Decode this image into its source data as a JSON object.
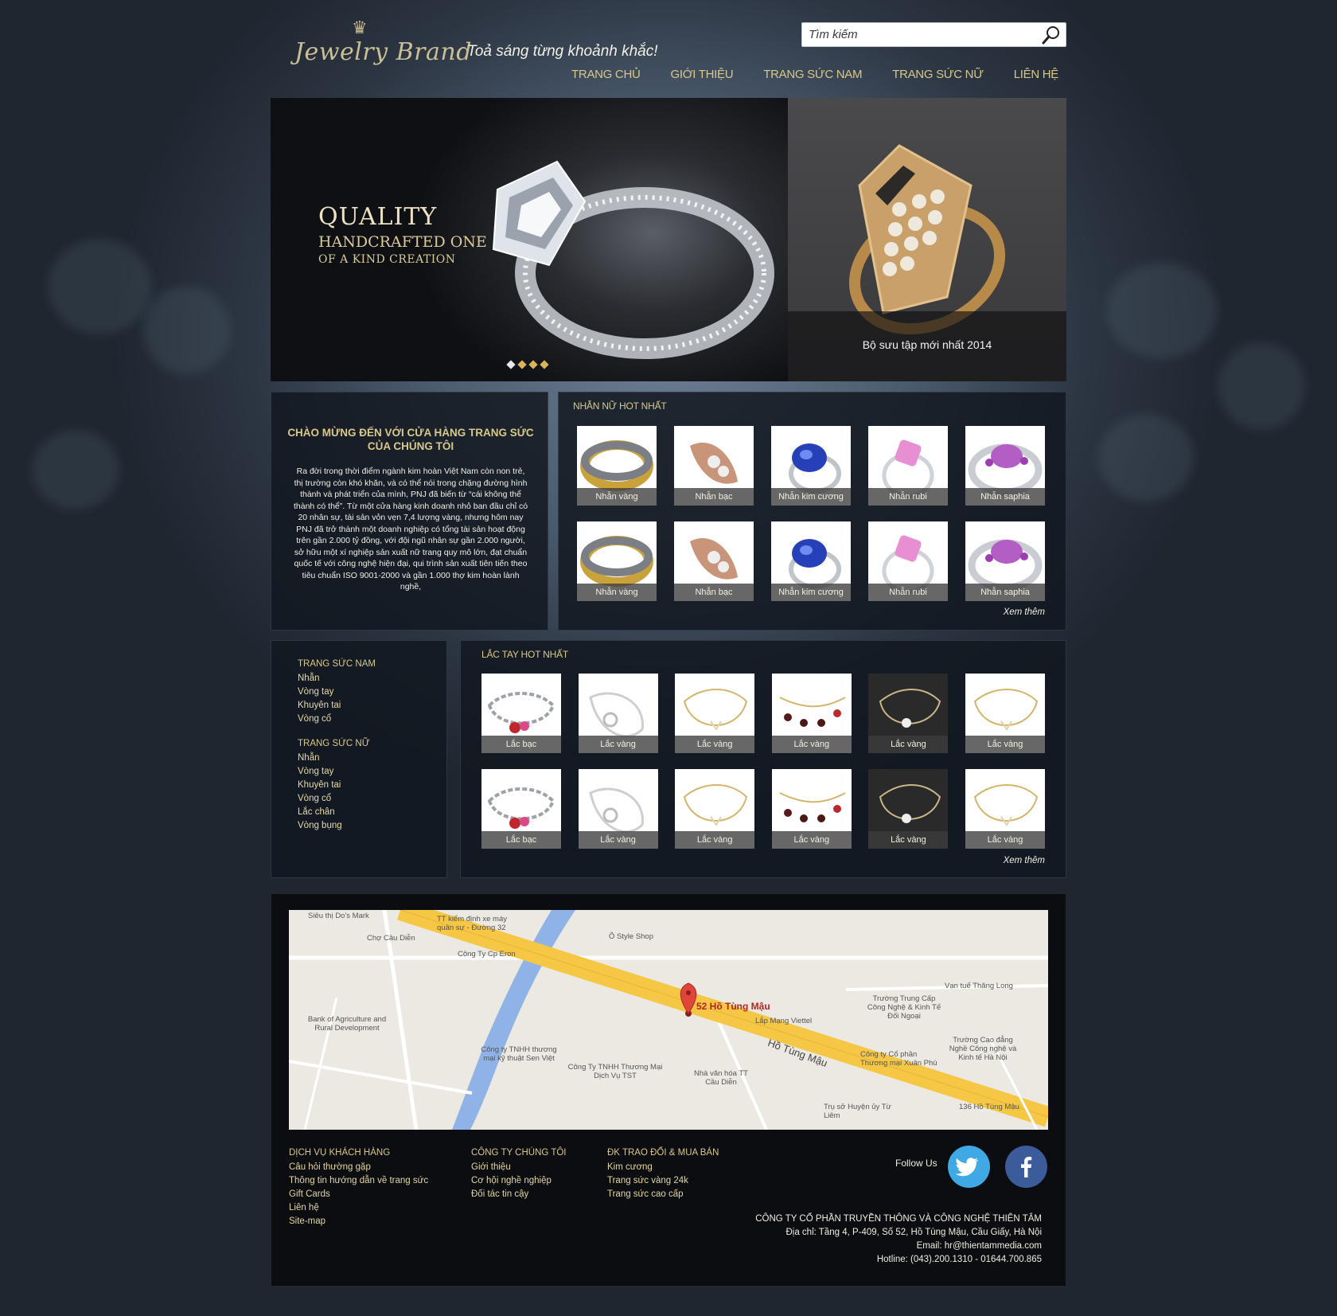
{
  "header": {
    "brand": "Jewelry Brand",
    "tagline": "Toả sáng từng khoảnh khắc!",
    "search_placeholder": "Tìm kiếm",
    "nav": [
      "TRANG CHỦ",
      "GIỚI THIỆU",
      "TRANG SỨC NAM",
      "TRANG SỨC NỮ",
      "LIÊN HỆ"
    ]
  },
  "banner": {
    "line1": "QUALITY",
    "line2": "HANDCRAFTED ONE",
    "line3": "OF A KIND CREATION",
    "caption": "Bộ sưu tập mới nhất 2014",
    "slide_count": 4
  },
  "welcome": {
    "title": "CHÀO MỪNG ĐẾN VỚI CỬA HÀNG TRANG SỨC CỦA CHÚNG TÔI",
    "body": "Ra đời trong thời điểm ngành kim hoàn Việt Nam còn non trẻ, thị trường còn khó khăn, và có thể nói trong chặng đường hình thành và phát triển của mình, PNJ đã biến từ “cái không thể thành có thể”. Từ một cửa hàng kinh doanh nhỏ ban đầu chỉ có 20 nhân sự, tài sản vỏn vẹn 7,4 lượng vàng, nhưng hôm nay PNJ đã trở thành một doanh nghiệp có tổng tài sản hoạt động trên gần 2.000 tỷ đồng, với đội ngũ nhân sự gần 2.000 người, sở hữu một xí nghiệp sản xuất nữ trang quy mô lớn, đạt chuẩn quốc tế với công nghệ hiện đại, qui trình sản xuất tiên tiến theo tiêu chuẩn ISO 9001-2000 và gần 1.000 thợ kim hoàn lành nghề,"
  },
  "rings": {
    "title": "NHẪN NỮ HOT NHẤT",
    "items": [
      "Nhẫn vàng",
      "Nhẫn bạc",
      "Nhẫn kim cương",
      "Nhẫn rubi",
      "Nhẫn saphia",
      "Nhẫn vàng",
      "Nhẫn bạc",
      "Nhẫn kim cương",
      "Nhẫn rubi",
      "Nhẫn saphia"
    ],
    "more": "Xem thêm"
  },
  "sidebar": {
    "men_title": "TRANG SỨC NAM",
    "men_items": [
      "Nhẫn",
      "Vòng tay",
      "Khuyên tai",
      "Vòng cổ"
    ],
    "women_title": "TRANG SỨC NỮ",
    "women_items": [
      "Nhẫn",
      "Vòng tay",
      "Khuyên tai",
      "Vòng cổ",
      "Lắc chân",
      "Vòng bụng"
    ]
  },
  "bracelets": {
    "title": "LẮC TAY HOT NHẤT",
    "items": [
      "Lắc bạc",
      "Lắc vàng",
      "Lắc vàng",
      "Lắc vàng",
      "Lắc vàng",
      "Lắc vàng",
      "Lắc bạc",
      "Lắc vàng",
      "Lắc vàng",
      "Lắc vàng",
      "Lắc vàng",
      "Lắc vàng"
    ],
    "more": "Xem thêm"
  },
  "map": {
    "pin": "52 Hồ Tùng Mậu",
    "road": "Hồ Tùng Mậu",
    "labels": [
      "Siêu thị Do's Mark",
      "TT kiểm định xe máy quân sự - Đường 32",
      "Chợ Cầu Diễn",
      "Công Ty Cp Eron",
      "Ô Style Shop",
      "Vạn tuế Thăng Long",
      "Trường Trung Cấp Công Nghệ & Kinh Tế Đối Ngoại",
      "Lắp Mạng Viettel",
      "Bank of Agriculture and Rural Development",
      "Công ty TNHH thương mại kỹ thuật Sen Việt",
      "Công Ty TNHH Thương Mại Dịch Vụ TST",
      "Nhà văn hóa TT Cầu Diễn",
      "Công ty Cổ phần Thương mại Xuân Phú",
      "Trường Cao đẳng Nghề Công nghệ và Kinh tế Hà Nội",
      "Trụ sở Huyện ủy Từ Liêm",
      "136 Hồ Tùng Mậu"
    ]
  },
  "footer": {
    "col1_title": "DỊCH VỤ KHÁCH HÀNG",
    "col1": [
      "Câu hỏi thường gặp",
      "Thông tin hướng dẫn về trang sức",
      "Gift Cards",
      "Liên hệ",
      "Site-map"
    ],
    "col2_title": "CÔNG TY CHÚNG TÔI",
    "col2": [
      "Giới thiệu",
      "Cơ hội nghề nghiệp",
      "Đối tác tin cậy"
    ],
    "col3_title": "ĐK TRAO ĐỔI & MUA BÁN",
    "col3": [
      "Kim cương",
      "Trang sức vàng 24k",
      "Trang sức cao cấp"
    ],
    "follow": "Follow Us",
    "company": "CÔNG TY CỔ PHẦN TRUYỀN THÔNG VÀ CÔNG NGHỆ THIÊN TÂM",
    "address": "Địa chỉ: Tầng 4, P-409, Số 52, Hồ Tùng Mậu, Cầu Giấy, Hà Nội",
    "email": "Email: hr@thientammedia.com",
    "hotline": "Hotline: (043).200.1310 - 01644.700.865"
  },
  "colors": {
    "gold": "#d9c889",
    "twitter": "#3fa9e6",
    "facebook": "#3b5b9b"
  }
}
